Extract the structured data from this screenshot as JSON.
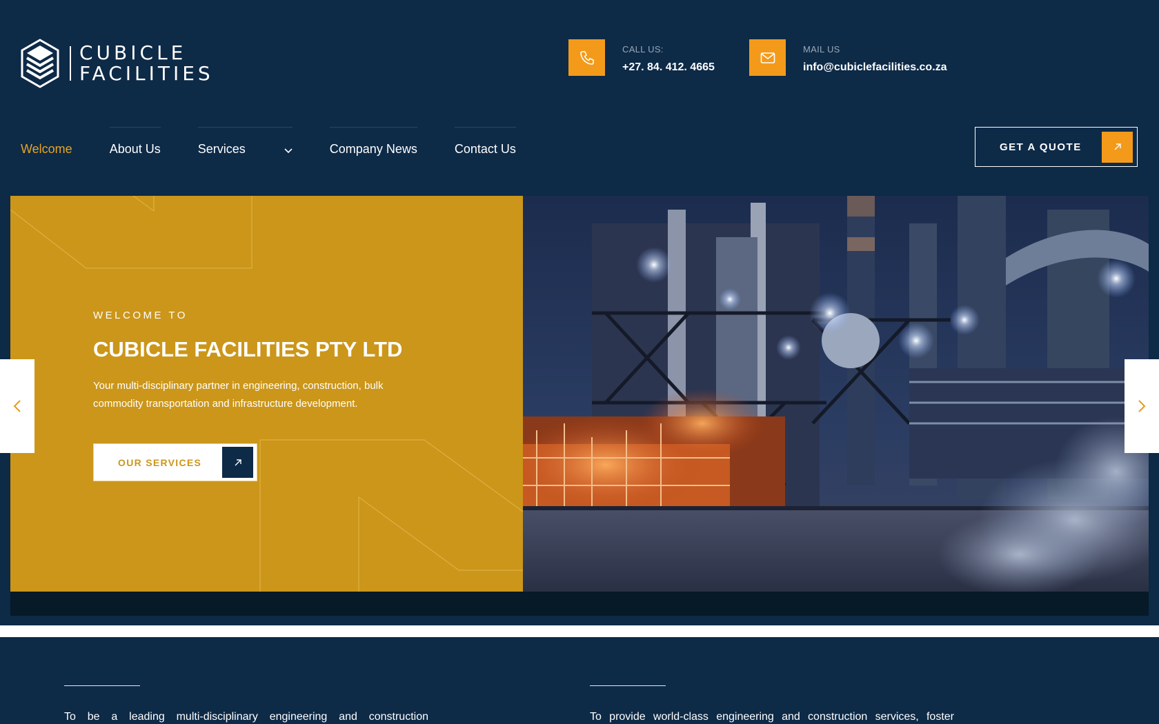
{
  "brand": {
    "name_line1": "CUBICLE",
    "name_line2": "FACILITIES"
  },
  "contact": {
    "phone_label": "CALL US:",
    "phone_value": "+27. 84. 412. 4665",
    "mail_label": "MAIL US",
    "mail_value": "info@cubiclefacilities.co.za"
  },
  "nav": {
    "items": [
      {
        "label": "Welcome",
        "active": true
      },
      {
        "label": "About Us"
      },
      {
        "label": "Services",
        "dropdown": true
      },
      {
        "label": "Company News"
      },
      {
        "label": "Contact Us"
      }
    ],
    "cta": "GET A QUOTE"
  },
  "hero": {
    "kicker": "WELCOME TO",
    "title": "CUBICLE FACILITIES PTY LTD",
    "description": "Your multi-disciplinary partner in engineering, construction, bulk commodity transportation and infrastructure development.",
    "button": "OUR SERVICES"
  },
  "lower": {
    "left_text": "To be a leading multi-disciplinary engineering and construction",
    "right_text": "To provide world-class engineering and construction services, foster"
  },
  "colors": {
    "navy": "#0d2a47",
    "gold": "#cb961a",
    "orange": "#f39a1b",
    "active_nav": "#e6a425"
  },
  "icons": [
    "logo-cube-icon",
    "phone-icon",
    "mail-icon",
    "chevron-down-icon",
    "arrow-up-right-icon",
    "chevron-left-icon",
    "chevron-right-icon"
  ]
}
